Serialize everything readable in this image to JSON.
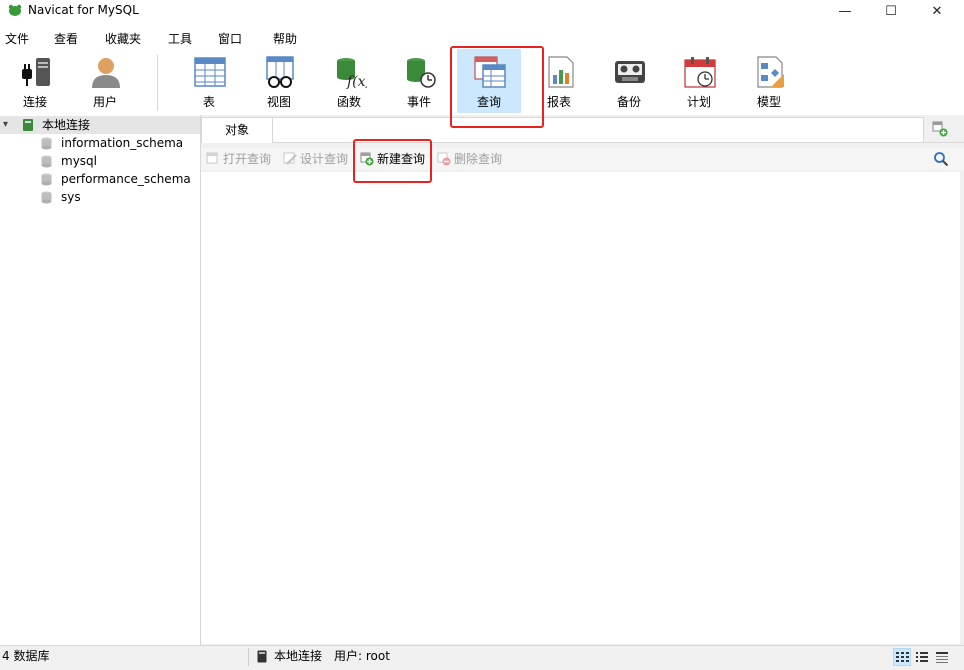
{
  "window": {
    "title": "Navicat for MySQL",
    "minimize": "—",
    "maximize": "☐",
    "close": "✕"
  },
  "menu": [
    "文件",
    "查看",
    "收藏夹",
    "工具",
    "窗口",
    "帮助"
  ],
  "toolbar": {
    "connect": "连接",
    "user": "用户",
    "table": "表",
    "view": "视图",
    "function": "函数",
    "event": "事件",
    "query": "查询",
    "report": "报表",
    "backup": "备份",
    "schedule": "计划",
    "model": "模型"
  },
  "tree": {
    "connection": "本地连接",
    "databases": [
      "information_schema",
      "mysql",
      "performance_schema",
      "sys"
    ]
  },
  "tabs": {
    "objects": "对象"
  },
  "object_toolbar": {
    "open": "打开查询",
    "design": "设计查询",
    "new": "新建查询",
    "delete": "删除查询"
  },
  "status": {
    "db_count": "4 数据库",
    "connection": "本地连接",
    "user": "用户: root"
  },
  "colors": {
    "highlight": "#e8231f",
    "selected": "#cce8ff"
  }
}
